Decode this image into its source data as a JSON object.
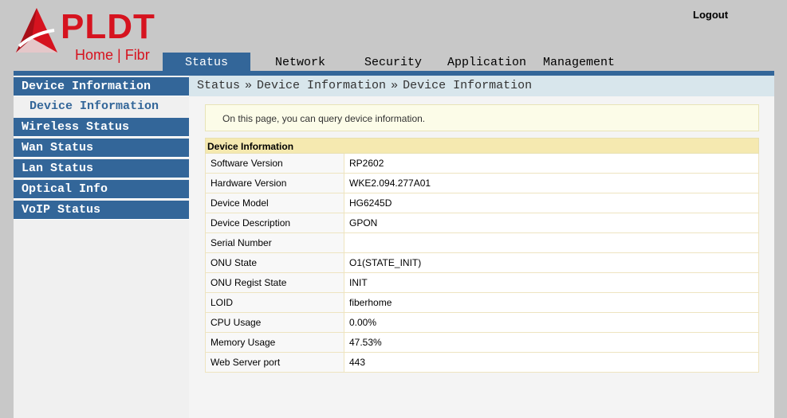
{
  "logo": {
    "wordmark": "PLDT",
    "subtitle": "Home | Fibr"
  },
  "header": {
    "logout": "Logout"
  },
  "nav": {
    "tabs": [
      {
        "label": "Status"
      },
      {
        "label": "Network"
      },
      {
        "label": "Security"
      },
      {
        "label": "Application"
      },
      {
        "label": "Management"
      }
    ]
  },
  "sidebar": {
    "items": [
      {
        "label": "Device Information"
      },
      {
        "label": "Device Information"
      },
      {
        "label": "Wireless Status"
      },
      {
        "label": "Wan Status"
      },
      {
        "label": "Lan Status"
      },
      {
        "label": "Optical Info"
      },
      {
        "label": "VoIP Status"
      }
    ]
  },
  "breadcrumb": {
    "parts": [
      "Status",
      "Device Information",
      "Device Information"
    ],
    "separator": "»"
  },
  "info": {
    "text": "On this page, you can query device information."
  },
  "table": {
    "title": "Device Information",
    "rows": [
      {
        "label": "Software Version",
        "value": "RP2602"
      },
      {
        "label": "Hardware Version",
        "value": "WKE2.094.277A01"
      },
      {
        "label": "Device Model",
        "value": "HG6245D"
      },
      {
        "label": "Device Description",
        "value": "GPON"
      },
      {
        "label": "Serial Number",
        "value": ""
      },
      {
        "label": "ONU State",
        "value": "O1(STATE_INIT)"
      },
      {
        "label": "ONU Regist State",
        "value": "INIT"
      },
      {
        "label": "LOID",
        "value": "fiberhome"
      },
      {
        "label": "CPU Usage",
        "value": "0.00%"
      },
      {
        "label": "Memory Usage",
        "value": "47.53%"
      },
      {
        "label": "Web Server port",
        "value": "443"
      }
    ]
  },
  "colors": {
    "brand_red": "#d6131f",
    "nav_blue": "#336699",
    "header_yellow": "#f5e9b0"
  }
}
